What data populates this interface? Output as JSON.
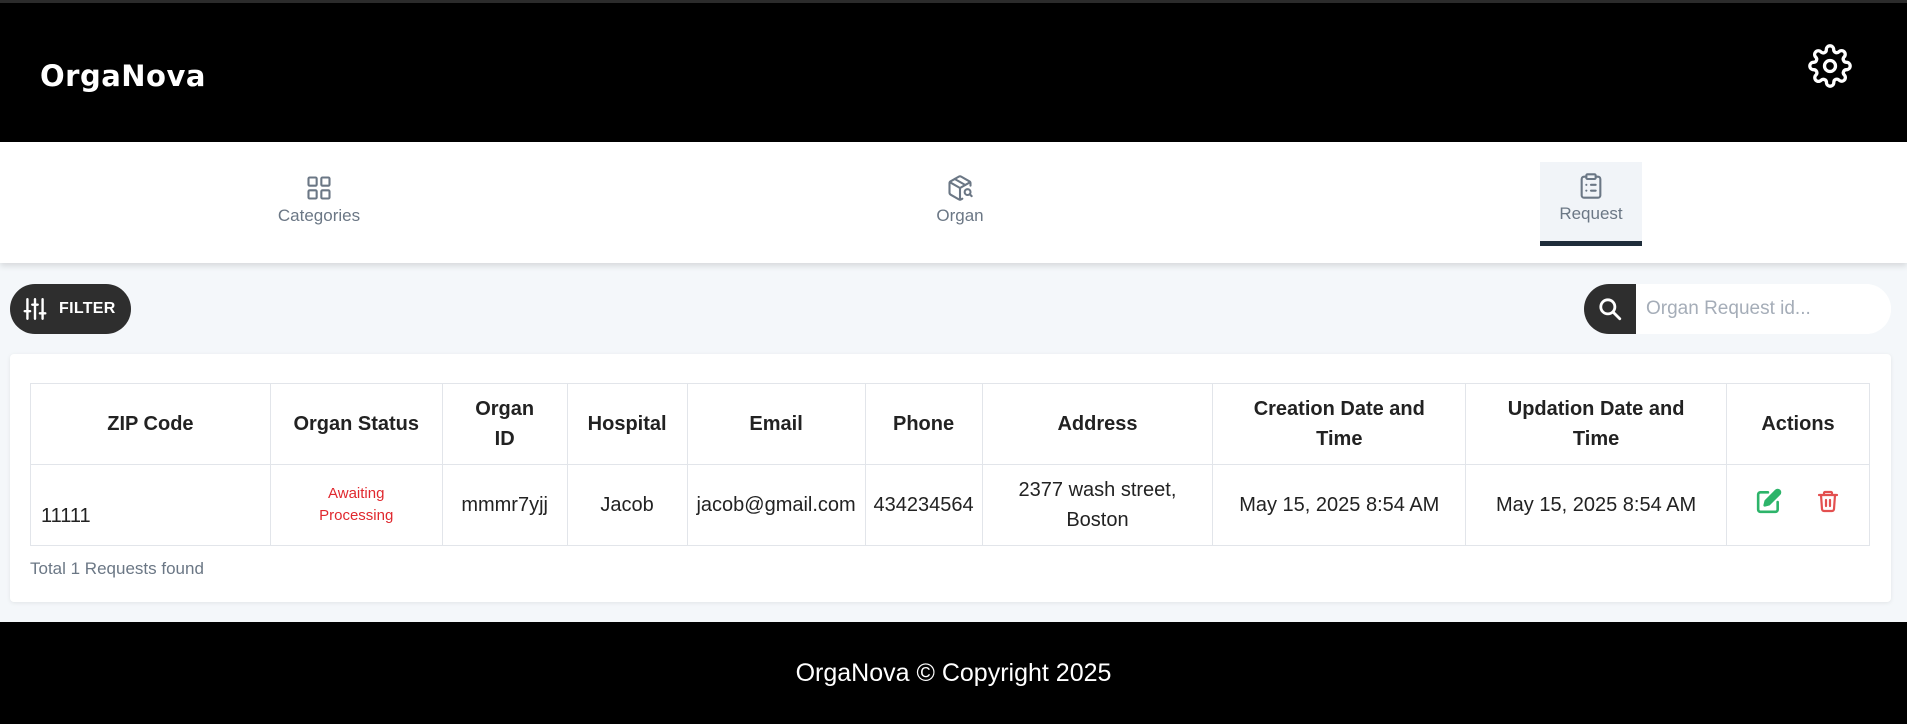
{
  "header": {
    "brand": "OrgaNova",
    "settings_icon": "gear-icon"
  },
  "nav": {
    "items": [
      {
        "label": "Categories",
        "icon": "grid-icon",
        "active": false
      },
      {
        "label": "Organ",
        "icon": "package-search-icon",
        "active": false
      },
      {
        "label": "Request",
        "icon": "clipboard-list-icon",
        "active": true
      }
    ]
  },
  "toolbar": {
    "filter_label": "FILTER",
    "search_placeholder": "Organ Request id..."
  },
  "table": {
    "headers": {
      "zip": "ZIP Code",
      "status": "Organ Status",
      "organ_id_1": "Organ",
      "organ_id_2": "ID",
      "hospital": "Hospital",
      "email": "Email",
      "phone": "Phone",
      "address": "Address",
      "created_1": "Creation Date and",
      "created_2": "Time",
      "updated_1": "Updation Date and",
      "updated_2": "Time",
      "actions": "Actions"
    },
    "rows": [
      {
        "zip": "11111",
        "status_1": "Awaiting",
        "status_2": "Processing",
        "organ_id": "mmmr7yjj",
        "hospital": "Jacob",
        "email": "jacob@gmail.com",
        "phone": "434234564",
        "address_1": "2377 wash street,",
        "address_2": "Boston",
        "created": "May 15, 2025 8:54 AM",
        "updated": "May 15, 2025 8:54 AM"
      }
    ],
    "total_text": "Total 1 Requests found"
  },
  "footer": {
    "text": "OrgaNova © Copyright 2025"
  },
  "colors": {
    "header_bg": "#000000",
    "status_red": "#e0282e",
    "edit_green": "#2db46a",
    "delete_red": "#e35050",
    "nav_active_border": "#1f2d3a"
  }
}
